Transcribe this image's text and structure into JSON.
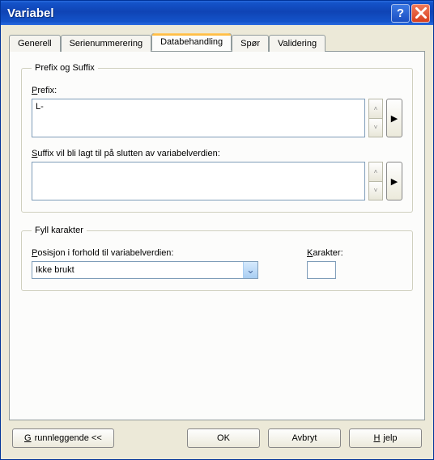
{
  "window": {
    "title": "Variabel"
  },
  "tabs": {
    "generell": "Generell",
    "serienummerering": "Serienummerering",
    "databehandling": "Databehandling",
    "spor": "Spør",
    "validering": "Validering"
  },
  "groups": {
    "prefix_suffix": {
      "legend": "Prefix og Suffix",
      "prefix_label": "Prefix:",
      "prefix_value": "L-",
      "suffix_label": "Suffix vil bli lagt til på slutten av variabelverdien:",
      "suffix_value": ""
    },
    "fill": {
      "legend": "Fyll karakter",
      "position_label": "Posisjon i forhold til variabelverdien:",
      "position_value": "Ikke brukt",
      "char_label": "Karakter:",
      "char_value": ""
    }
  },
  "buttons": {
    "basic": "Grunnleggende <<",
    "ok": "OK",
    "cancel": "Avbryt",
    "help": "Hjelp"
  },
  "glyphs": {
    "triangle_right": "▶",
    "up": "˄",
    "down": "˅",
    "dropdown": "⌄"
  }
}
